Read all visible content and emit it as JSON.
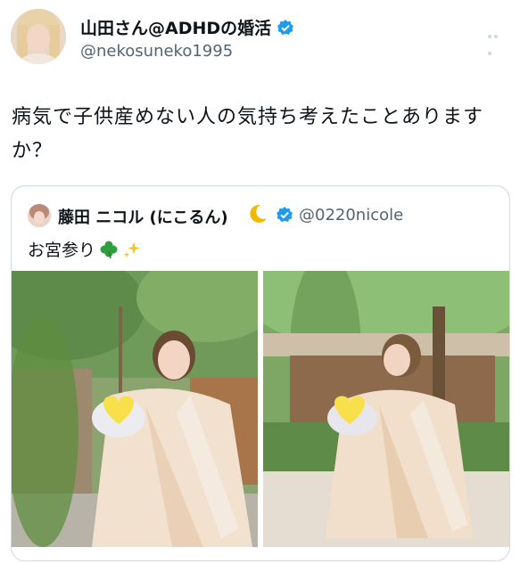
{
  "tweet": {
    "author_name": "山田さん@ADHDの婚活",
    "handle": "@nekosuneko1995",
    "text": "病気で子供産めない人の気持ち考えたことありますか？"
  },
  "quote": {
    "author_name": "藤田 ニコル (にこるん)",
    "handle": "@0220nicole",
    "text": "お宮参り"
  },
  "icons": {
    "verified": "verified-badge-icon",
    "moon": "crescent-moon-icon",
    "clover": "four-leaf-clover-icon",
    "sparkles": "sparkles-icon",
    "more": "more-options-icon"
  },
  "colors": {
    "verified_blue": "#1d9bf0",
    "text": "#0f1419",
    "secondary_text": "#536471",
    "border": "#cfd9de"
  }
}
